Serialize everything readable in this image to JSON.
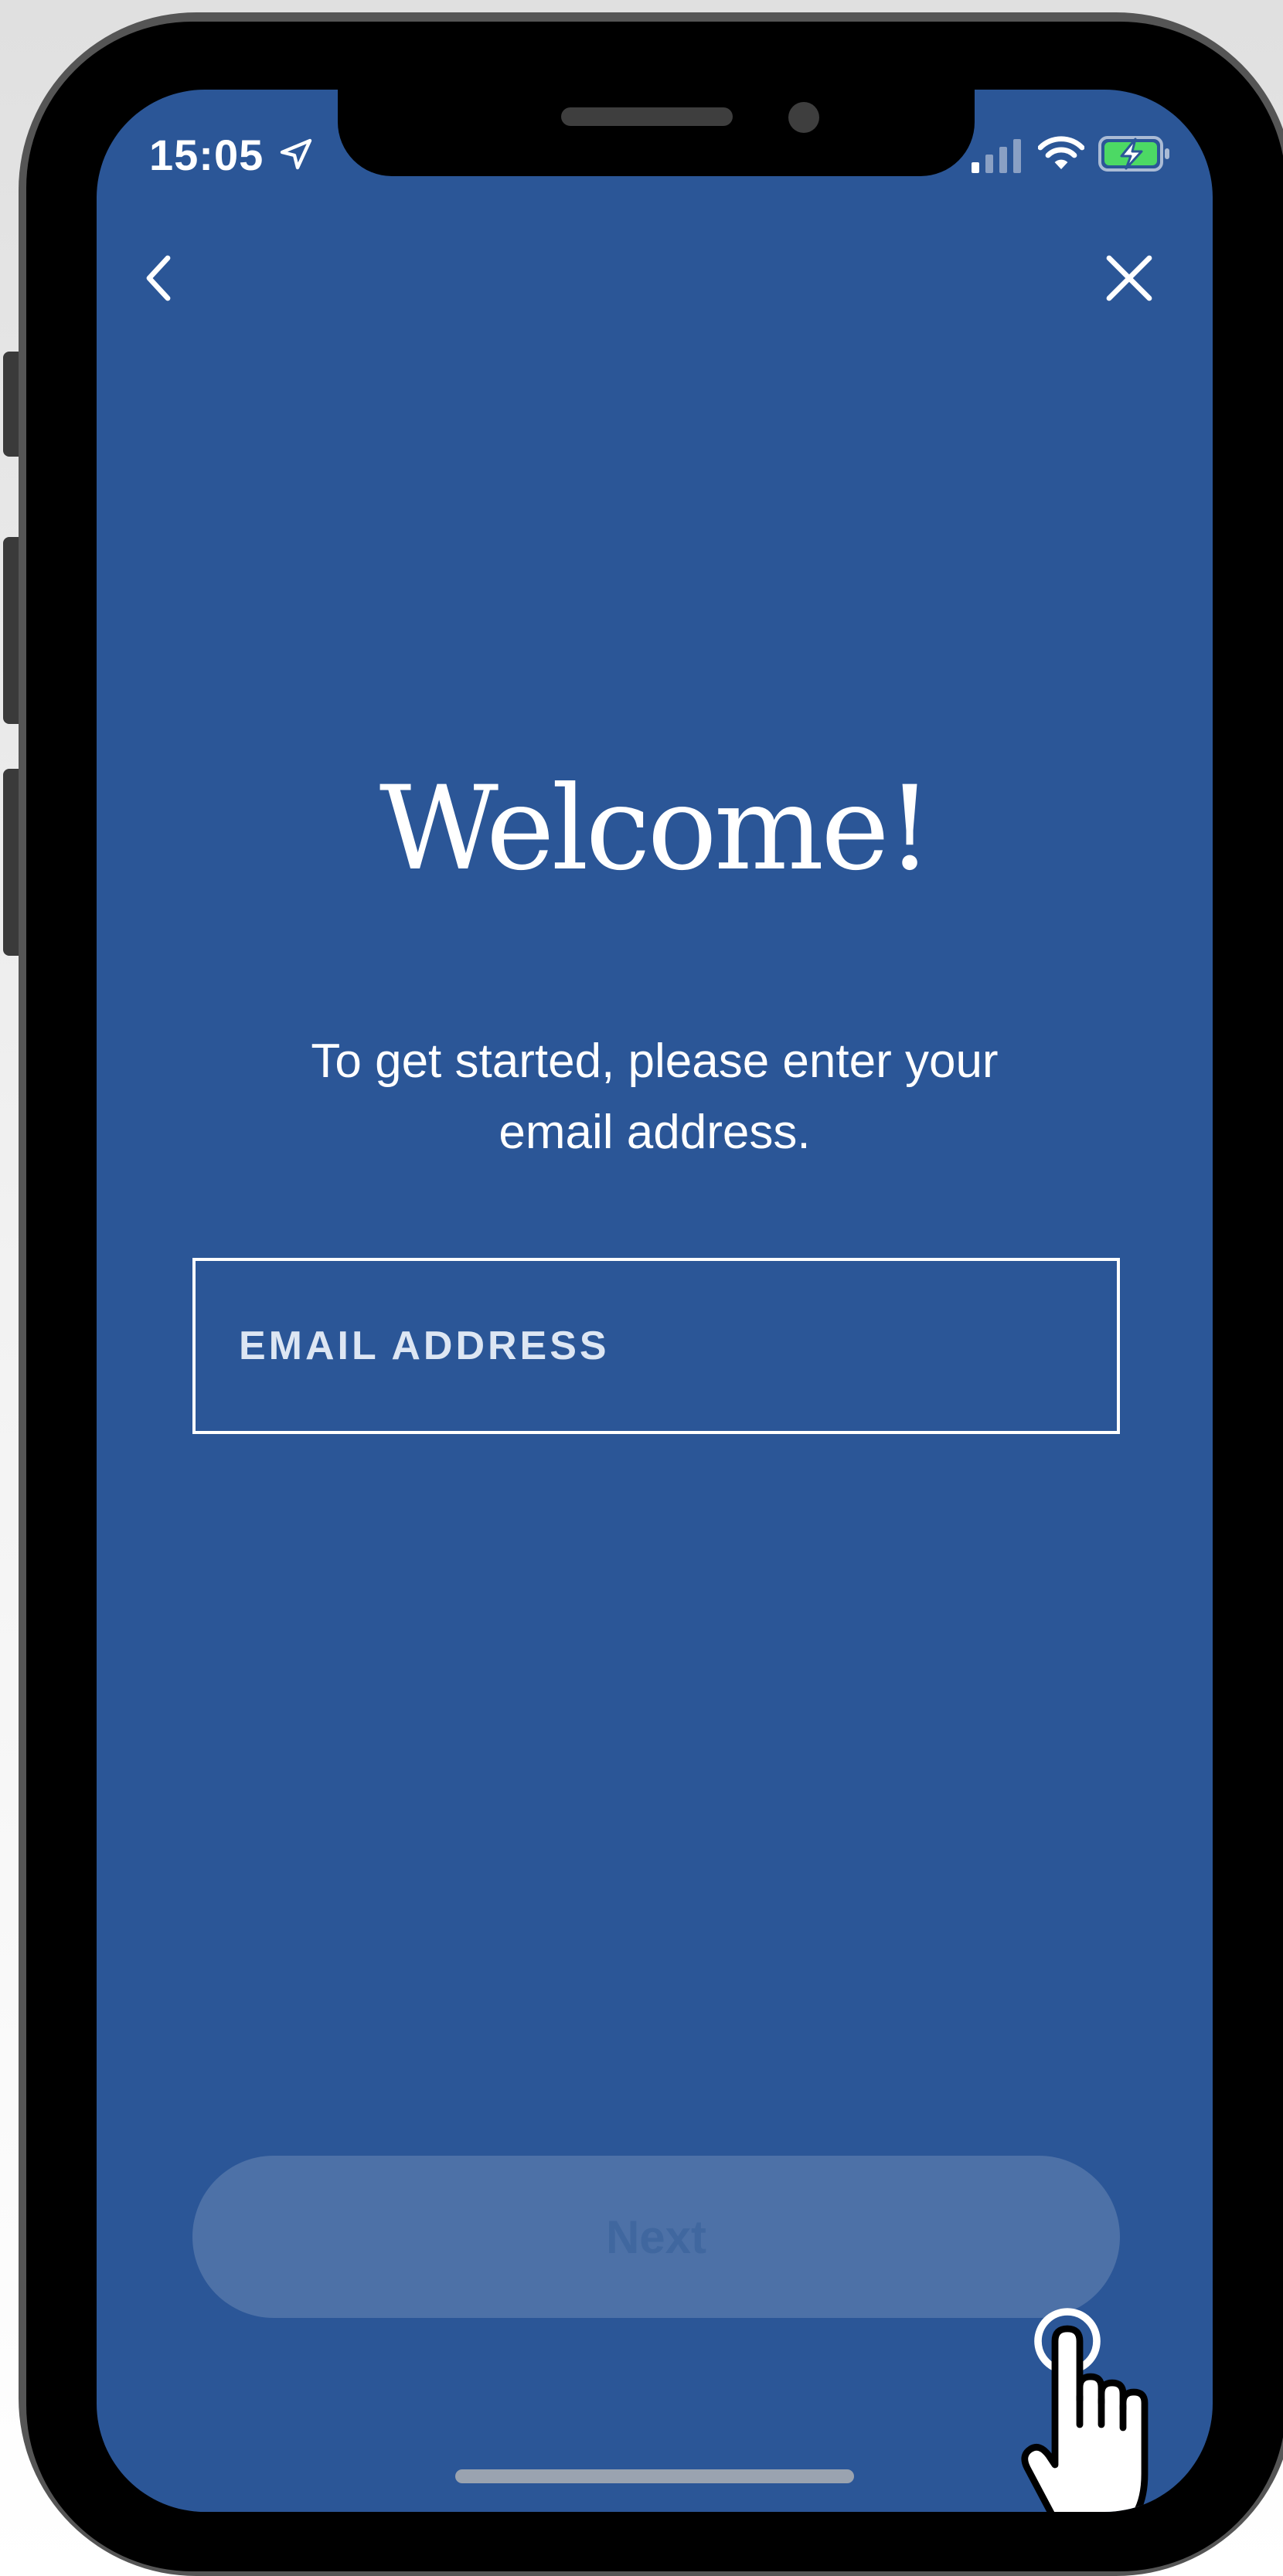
{
  "status_bar": {
    "time": "15:05",
    "icons": [
      "location-arrow-icon",
      "cellular-signal-icon",
      "wifi-icon",
      "battery-charging-icon"
    ]
  },
  "nav": {
    "back_icon": "chevron-left-icon",
    "close_icon": "close-icon"
  },
  "main": {
    "title": "Welcome!",
    "subtitle": "To get started, please enter your email address.",
    "email_placeholder": "EMAIL ADDRESS",
    "email_value": "",
    "next_label": "Next"
  },
  "colors": {
    "screen_background": "#2b5697",
    "button_background": "#4d71a7",
    "button_text": "#40679f",
    "foreground": "#ffffff"
  },
  "overlay": {
    "pointer_icon": "tap-hand-icon"
  }
}
